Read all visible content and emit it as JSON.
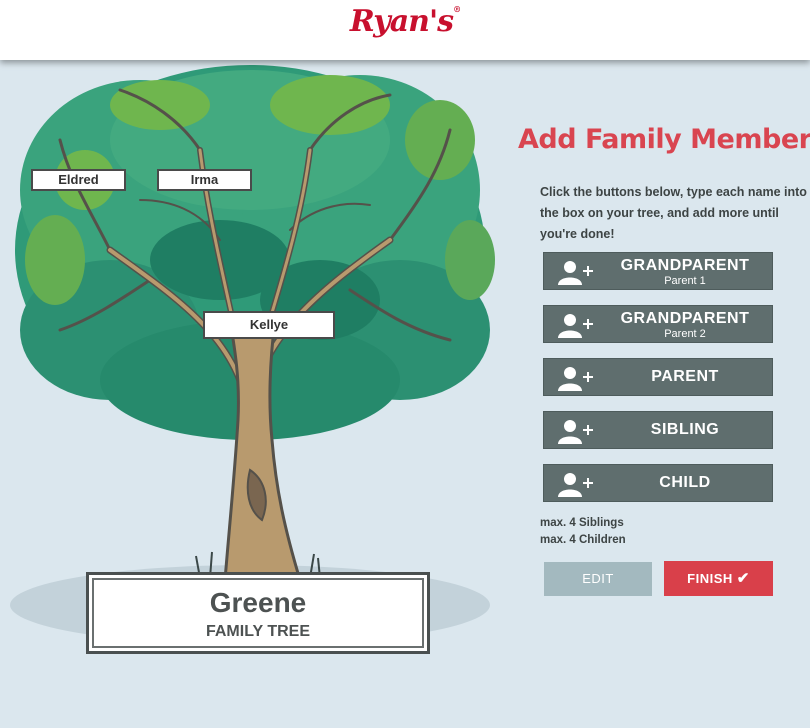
{
  "header": {
    "logo_text": "Ryan's",
    "logo_mark": "®"
  },
  "tree": {
    "name_tags": [
      {
        "role": "grandparent-1",
        "name": "Eldred"
      },
      {
        "role": "grandparent-2",
        "name": "Irma"
      },
      {
        "role": "parent",
        "name": "Kellye"
      }
    ],
    "family_surname": "Greene",
    "family_subtitle": "FAMILY TREE"
  },
  "panel": {
    "title": "Add Family Member",
    "instructions": "Click the buttons below, type each name into the box on your tree, and add more until you're done!",
    "buttons": [
      {
        "label": "GRANDPARENT",
        "sub": "Parent 1",
        "icon": "add-user-icon"
      },
      {
        "label": "GRANDPARENT",
        "sub": "Parent 2",
        "icon": "add-user-icon"
      },
      {
        "label": "PARENT",
        "sub": "",
        "icon": "add-user-icon"
      },
      {
        "label": "SIBLING",
        "sub": "",
        "icon": "add-user-icon"
      },
      {
        "label": "CHILD",
        "sub": "",
        "icon": "add-user-icon"
      }
    ],
    "limits": [
      "max. 4 Siblings",
      "max. 4 Children"
    ],
    "edit_label": "EDIT",
    "finish_label": "FINISH",
    "finish_icon": "check-icon"
  },
  "colors": {
    "brand_red": "#c8102e",
    "accent_red": "#d94550",
    "button_gray": "#5f6e6e",
    "edit_blue": "#a3b9bf",
    "background": "#dbe7ee"
  }
}
